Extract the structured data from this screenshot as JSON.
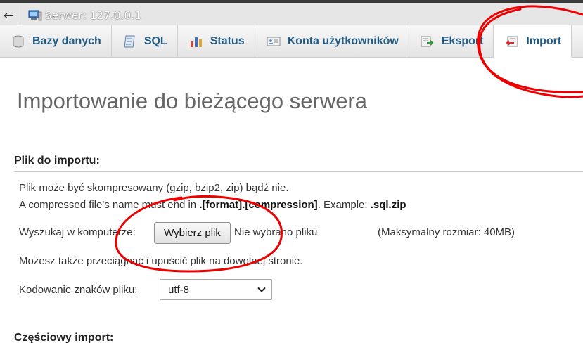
{
  "topbar": {
    "back_icon": "left-arrow-icon",
    "server_icon": "server-icon",
    "breadcrumb": "Serwer: 127.0.0.1"
  },
  "tabs": [
    {
      "label": "Bazy danych",
      "icon": "database-icon",
      "active": false
    },
    {
      "label": "SQL",
      "icon": "sql-icon",
      "active": false
    },
    {
      "label": "Status",
      "icon": "status-chart-icon",
      "active": false
    },
    {
      "label": "Konta użytkowników",
      "icon": "user-accounts-icon",
      "active": false
    },
    {
      "label": "Eksport",
      "icon": "export-icon",
      "active": false
    },
    {
      "label": "Import",
      "icon": "import-icon",
      "active": true
    }
  ],
  "main": {
    "title": "Importowanie do bieżącego serwera",
    "file_section": {
      "heading": "Plik do importu:",
      "compress_note": "Plik może być skompresowany (gzip, bzip2, zip) bądź nie.",
      "name_note_prefix": "A compressed file's name must end in ",
      "name_note_format": ".[format].[compression]",
      "name_note_mid": ". Example: ",
      "name_note_example": ".sql.zip",
      "browse_label": "Wyszukaj w komputerze:",
      "choose_button": "Wybierz plik",
      "no_file": "Nie wybrano pliku",
      "max_size": "(Maksymalny rozmiar: 40MB)",
      "drag_note": "Możesz także przeciągnąć i upuścić plik na dowolnej stronie.",
      "encoding_label": "Kodowanie znaków pliku:",
      "encoding_value": "utf-8"
    },
    "partial_heading": "Częściowy import:"
  },
  "colors": {
    "tab_text": "#235a81",
    "annotation": "#ee0000"
  }
}
